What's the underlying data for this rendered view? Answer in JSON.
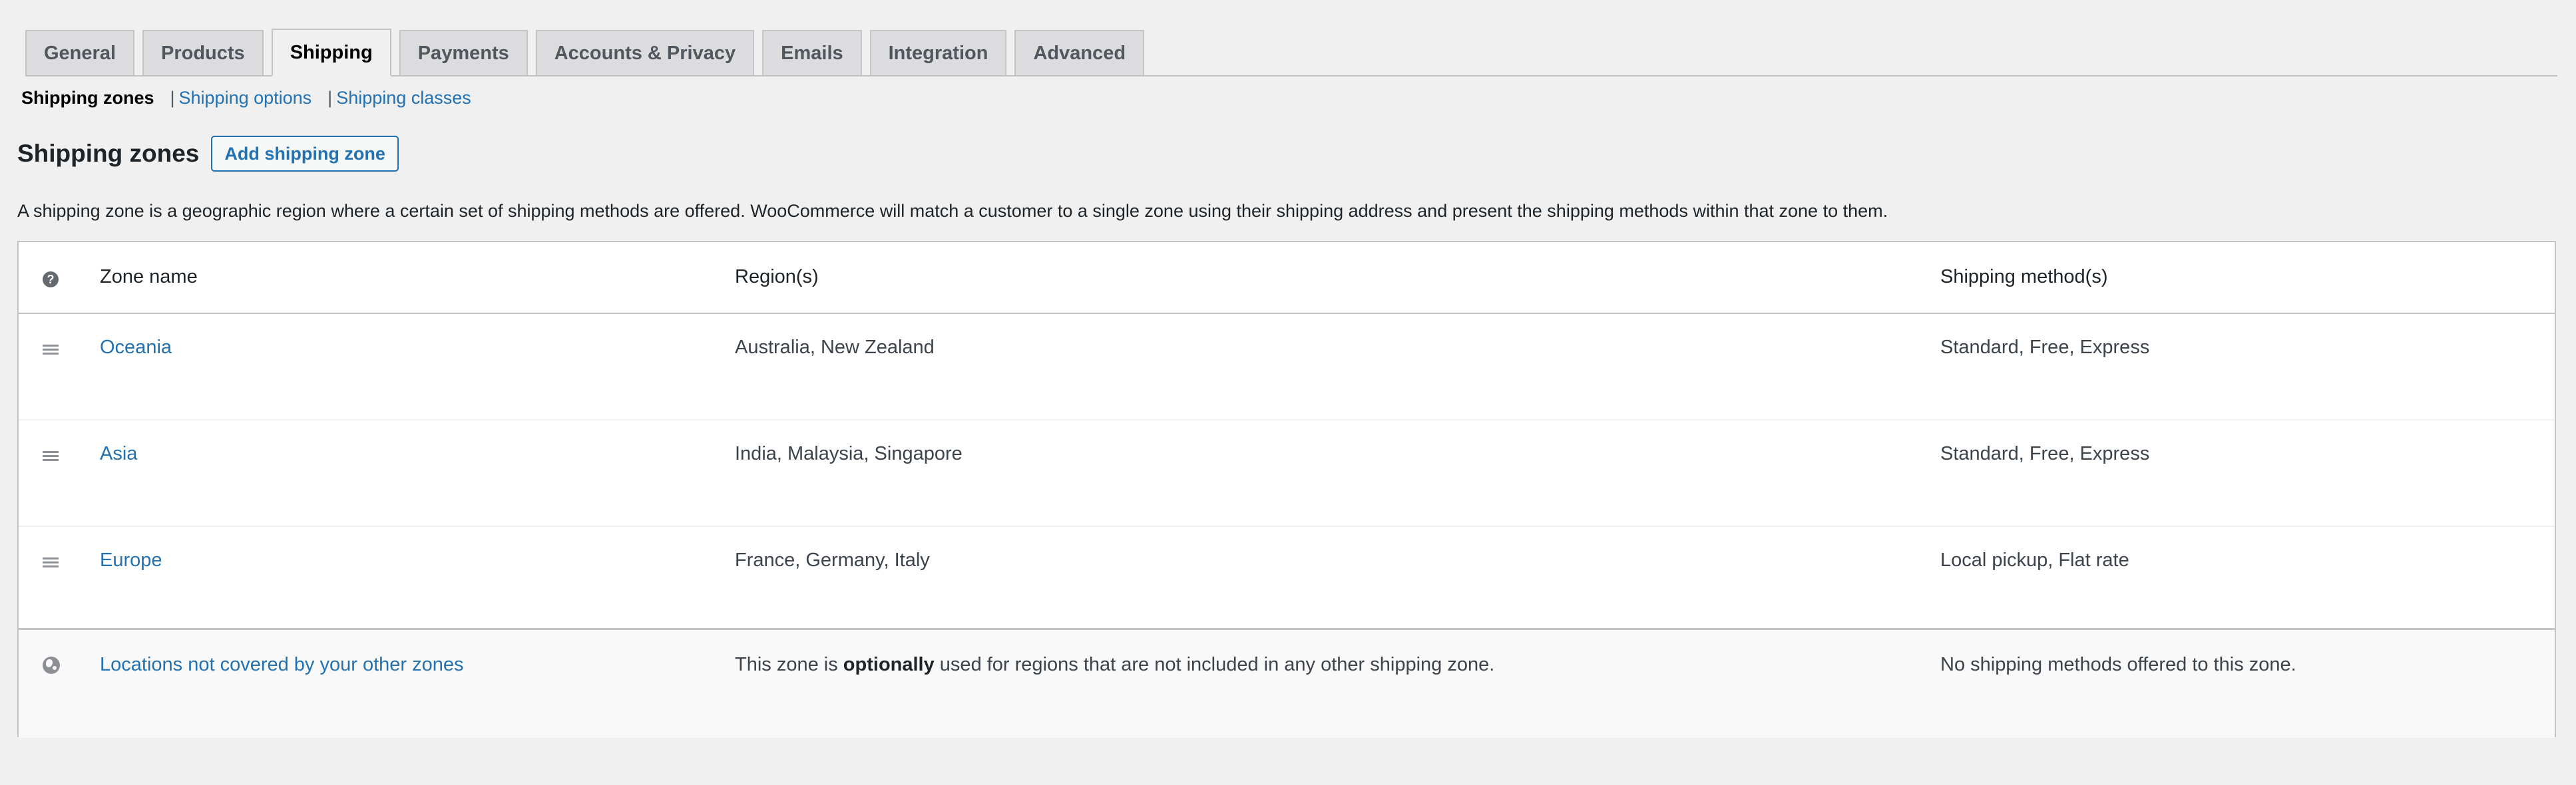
{
  "tabs": [
    {
      "label": "General",
      "active": false
    },
    {
      "label": "Products",
      "active": false
    },
    {
      "label": "Shipping",
      "active": true
    },
    {
      "label": "Payments",
      "active": false
    },
    {
      "label": "Accounts & Privacy",
      "active": false
    },
    {
      "label": "Emails",
      "active": false
    },
    {
      "label": "Integration",
      "active": false
    },
    {
      "label": "Advanced",
      "active": false
    }
  ],
  "subnav": {
    "current": "Shipping zones",
    "separator": "|",
    "links": [
      "Shipping options",
      "Shipping classes"
    ]
  },
  "heading": {
    "title": "Shipping zones",
    "add_button": "Add shipping zone"
  },
  "description": "A shipping zone is a geographic region where a certain set of shipping methods are offered. WooCommerce will match a customer to a single zone using their shipping address and present the shipping methods within that zone to them.",
  "table": {
    "headers": {
      "help_icon": "?",
      "zone_name": "Zone name",
      "regions": "Region(s)",
      "methods": "Shipping method(s)"
    },
    "zones": [
      {
        "name": "Oceania",
        "regions": "Australia, New Zealand",
        "methods": "Standard, Free, Express"
      },
      {
        "name": "Asia",
        "regions": "India, Malaysia, Singapore",
        "methods": "Standard, Free, Express"
      },
      {
        "name": "Europe",
        "regions": "France, Germany, Italy",
        "methods": "Local pickup, Flat rate"
      }
    ],
    "rest_of_world": {
      "name": "Locations not covered by your other zones",
      "desc_before": "This zone is ",
      "desc_bold": "optionally",
      "desc_after": " used for regions that are not included in any other shipping zone.",
      "methods": "No shipping methods offered to this zone."
    }
  },
  "icons": {
    "drag": "drag-handle-icon",
    "help": "help-icon",
    "globe": "globe-icon"
  },
  "colors": {
    "link": "#2271b1",
    "background": "#f0f0f1",
    "border": "#c3c4c7"
  }
}
